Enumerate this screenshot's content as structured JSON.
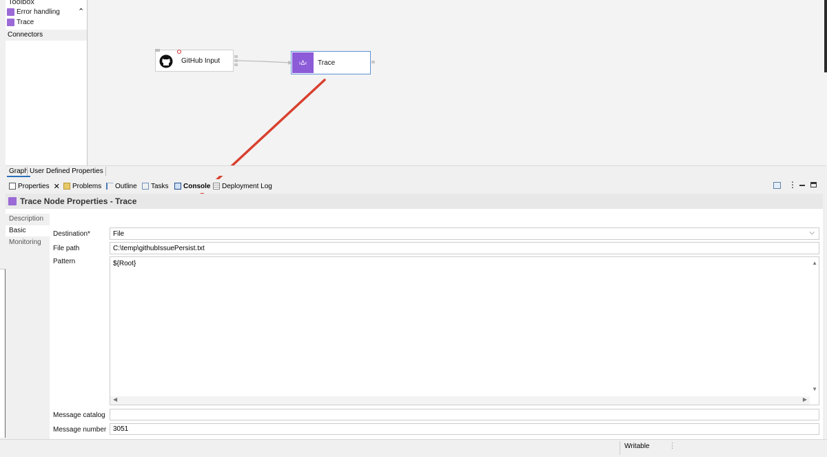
{
  "palette": {
    "title": "Toolbox",
    "items": [
      {
        "label": "Error handling",
        "icon": "error-handling-icon",
        "color": "#9b6ad6"
      },
      {
        "label": "Trace",
        "icon": "trace-icon",
        "color": "#9b6ad6"
      }
    ],
    "connectors_label": "Connectors"
  },
  "canvas": {
    "nodes": [
      {
        "label": "GitHub Input",
        "icon": "github-icon"
      },
      {
        "label": "Trace",
        "icon": "trace-icon",
        "icon_text": "›Δ‹",
        "accent": "#8c5bd8",
        "selected_border": "#5b8fd6"
      }
    ],
    "annotation_arrow_color": "#d9402f"
  },
  "editor_tabs": [
    "Graph",
    "User Defined Properties"
  ],
  "views": [
    {
      "label": "Properties",
      "icon": "properties-icon",
      "active": true
    },
    {
      "label": "Problems",
      "icon": "problems-icon"
    },
    {
      "label": "Outline",
      "icon": "outline-icon"
    },
    {
      "label": "Tasks",
      "icon": "tasks-icon"
    },
    {
      "label": "Console",
      "icon": "console-icon"
    },
    {
      "label": "Deployment Log",
      "icon": "deployment-log-icon"
    }
  ],
  "properties": {
    "title": "Trace Node Properties - Trace",
    "side_tabs": [
      "Description",
      "Basic",
      "Monitoring"
    ],
    "active_side_tab": "Basic",
    "fields": {
      "destination": {
        "label": "Destination*",
        "value": "File"
      },
      "file_path": {
        "label": "File path",
        "value": "C:\\temp\\githubIssuePersist.txt"
      },
      "pattern": {
        "label": "Pattern",
        "value": "${Root}"
      },
      "message_catalog": {
        "label": "Message catalog",
        "value": ""
      },
      "message_number": {
        "label": "Message number",
        "value": "3051"
      }
    }
  },
  "status": {
    "mode": "Writable"
  },
  "colors": {
    "accent": "#2a6ebb",
    "trace_purple": "#8c5bd8"
  }
}
